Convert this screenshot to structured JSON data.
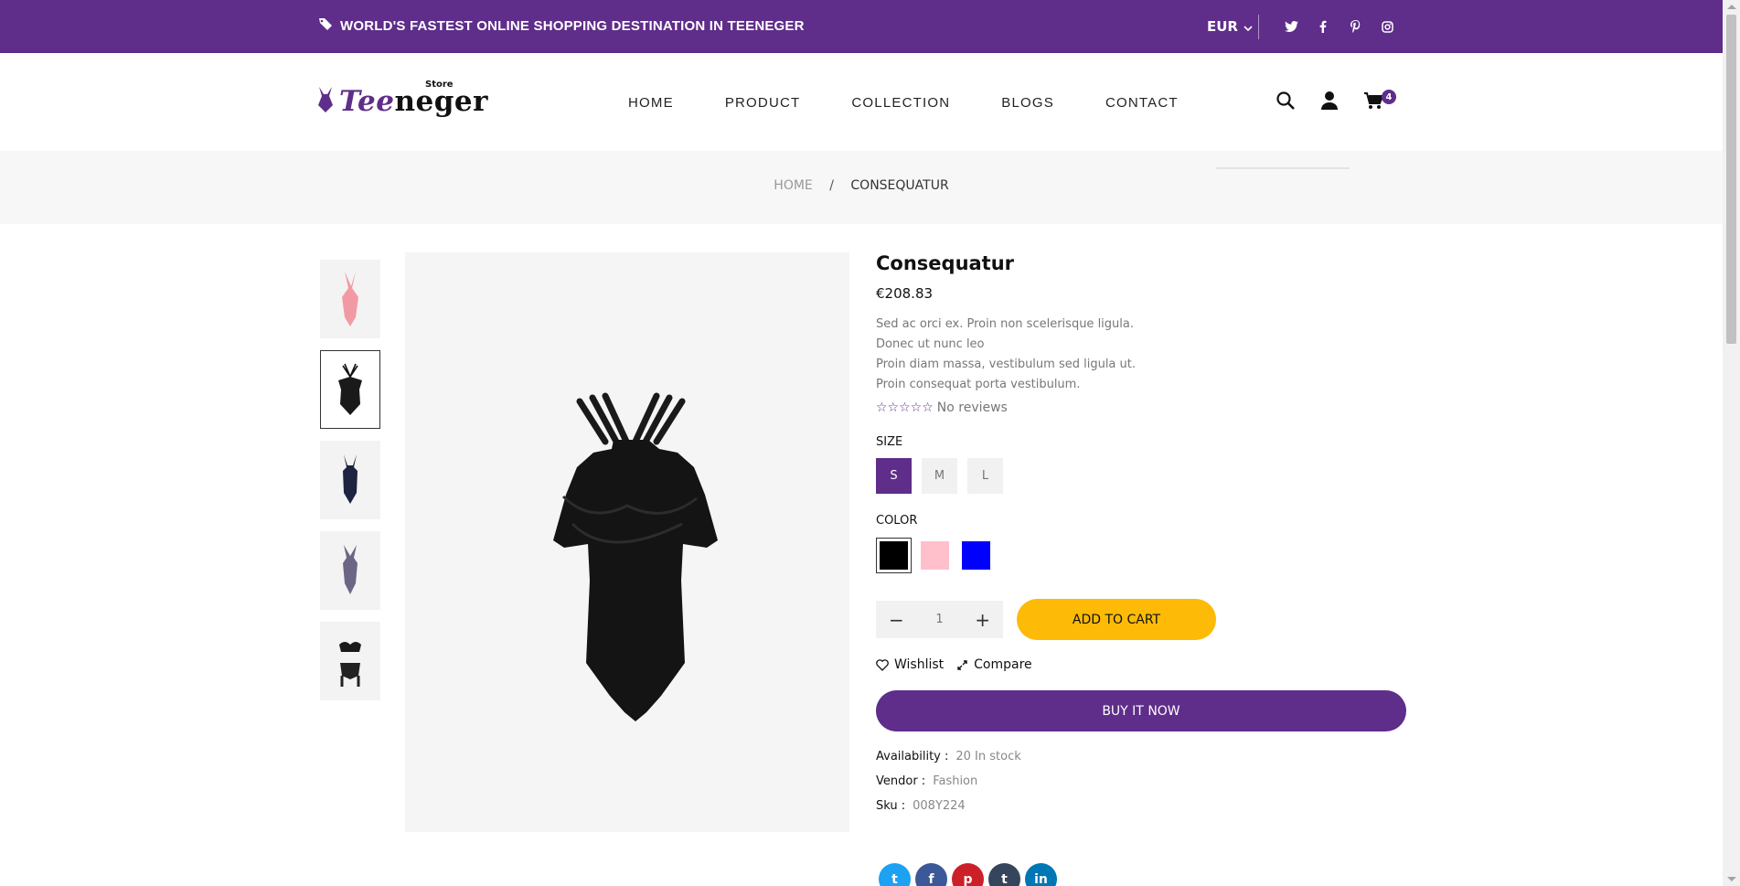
{
  "topbar": {
    "promo": "WORLD'S FASTEST ONLINE SHOPPING DESTINATION IN TEENEGER",
    "currency": "EUR",
    "socials": [
      "twitter-icon",
      "facebook-icon",
      "pinterest-icon",
      "instagram-icon"
    ]
  },
  "header": {
    "logo": {
      "part_a": "Tee",
      "part_b": "neger",
      "store": "Store"
    },
    "nav": [
      "HOME",
      "PRODUCT",
      "COLLECTION",
      "BLOGS",
      "CONTACT"
    ],
    "cart_count": "4"
  },
  "breadcrumb": {
    "home": "HOME",
    "separator": "/",
    "current": "CONSEQUATUR"
  },
  "product": {
    "title": "Consequatur",
    "price": "€208.83",
    "description": [
      "Sed ac orci ex. Proin non scelerisque ligula.",
      "Donec ut nunc leo",
      "Proin diam massa, vestibulum sed ligula ut.",
      "Proin consequat porta vestibulum."
    ],
    "stars": "☆☆☆☆☆",
    "reviews": "No reviews",
    "size_label": "SIZE",
    "sizes": [
      "S",
      "M",
      "L"
    ],
    "selected_size": "S",
    "color_label": "COLOR",
    "colors": [
      "#000000",
      "#ffc0cb",
      "#0000ff"
    ],
    "quantity": "1",
    "add_to_cart": "ADD TO CART",
    "wishlist": "Wishlist",
    "compare": "Compare",
    "buy_now": "BUY IT NOW",
    "availability_label": "Availability :",
    "availability": "20 In stock",
    "vendor_label": "Vendor :",
    "vendor": "Fashion",
    "sku_label": "Sku :",
    "sku": "008Y224",
    "share": [
      "twitter-icon",
      "facebook-icon",
      "pinterest-icon",
      "tumblr-icon",
      "linkedin-icon"
    ]
  },
  "colors": {
    "brand": "#5f2d8a",
    "accent": "#fdbb08"
  }
}
